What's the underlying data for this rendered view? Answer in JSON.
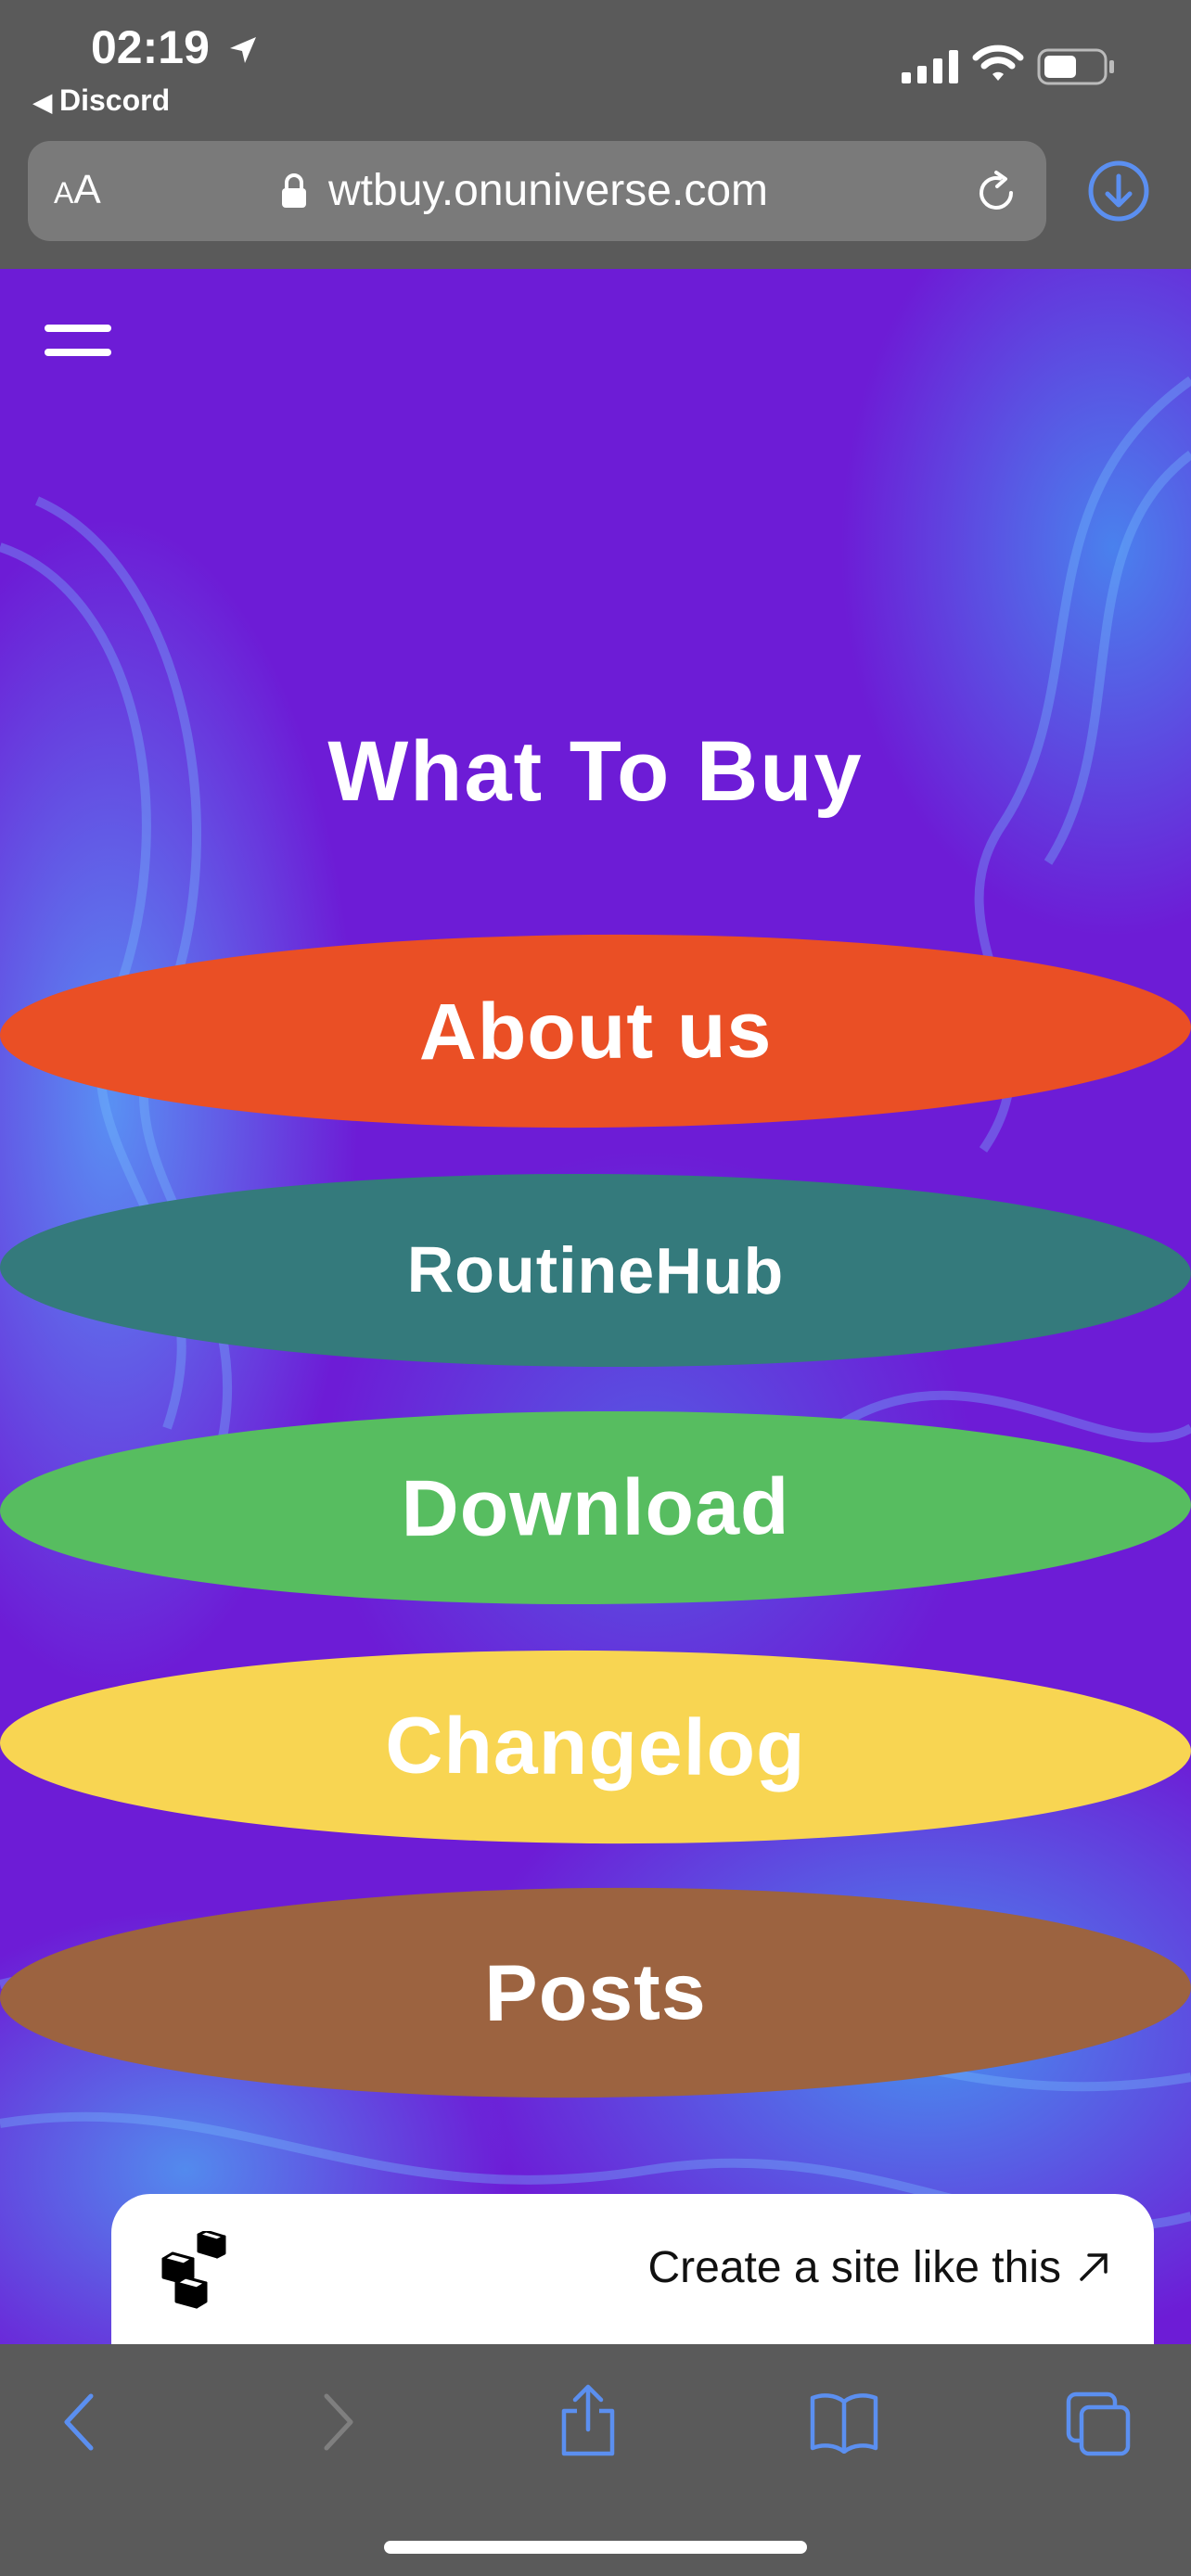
{
  "status_bar": {
    "time": "02:19",
    "back_app": "Discord",
    "icons": [
      "location-arrow-icon",
      "cellular-signal-icon",
      "wifi-icon",
      "battery-icon"
    ]
  },
  "address_bar": {
    "text_size_small": "A",
    "text_size_large": "A",
    "url": "wtbuy.onuniverse.com",
    "icons": [
      "lock-icon",
      "reload-icon",
      "download-icon"
    ],
    "accent_color": "#5b8ff0"
  },
  "page": {
    "title": "What To Buy",
    "menu_icon": "hamburger-menu-icon",
    "buttons": [
      {
        "label": "About us",
        "color": "#ea4f25"
      },
      {
        "label": "RoutineHub",
        "color": "#347a7c"
      },
      {
        "label": "Download",
        "color": "#57bd60"
      },
      {
        "label": "Changelog",
        "color": "#f8d552"
      },
      {
        "label": "Posts",
        "color": "#9c6340"
      }
    ],
    "background_color": "#6d1cd6"
  },
  "banner": {
    "label": "Create a site like this",
    "icons": [
      "cubes-logo-icon",
      "external-arrow-icon"
    ]
  },
  "toolbar": {
    "icons": [
      "back-icon",
      "forward-icon",
      "share-icon",
      "bookmarks-icon",
      "tabs-icon"
    ]
  }
}
